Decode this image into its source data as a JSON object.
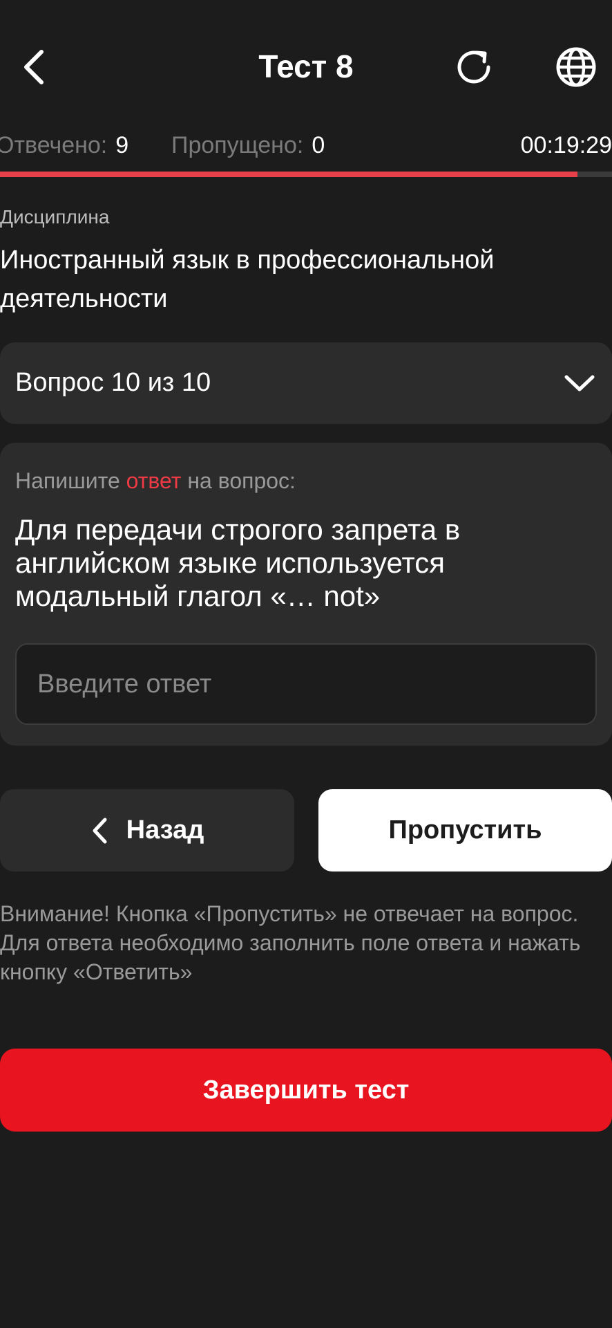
{
  "header": {
    "title": "Тест 8"
  },
  "stats": {
    "answered_label": "Отвечено:",
    "answered_value": "9",
    "skipped_label": "Пропущено:",
    "skipped_value": "0",
    "timer": "00:19:29"
  },
  "progress": {
    "fraction": 0.944
  },
  "discipline": {
    "label": "Дисциплина",
    "value": "Иностранный язык в профессиональной деятельности"
  },
  "question_selector": {
    "label": "Вопрос 10 из 10"
  },
  "question": {
    "instruction_before": "Напишите ",
    "instruction_accent": "ответ",
    "instruction_after": " на вопрос:",
    "text": "Для передачи строгого запрета в английском языке используется модальный глагол «… not»",
    "input_placeholder": "Введите ответ",
    "input_value": ""
  },
  "nav": {
    "back_label": "Назад",
    "skip_label": "Пропустить"
  },
  "warning": "Внимание! Кнопка «Пропустить» не отвечает на вопрос. Для ответа необходимо заполнить поле ответа и нажать кнопку «Ответить»",
  "finish": {
    "label": "Завершить тест"
  },
  "colors": {
    "background": "#1c1c1c",
    "card": "#2c2c2c",
    "accent_red": "#e8141f",
    "progress_red": "#e8404a",
    "text_muted": "#9a9a9a"
  },
  "icons": {
    "back": "chevron-left-icon",
    "refresh": "refresh-icon",
    "language": "globe-icon",
    "dropdown": "chevron-down-icon",
    "nav_back": "chevron-left-icon"
  }
}
